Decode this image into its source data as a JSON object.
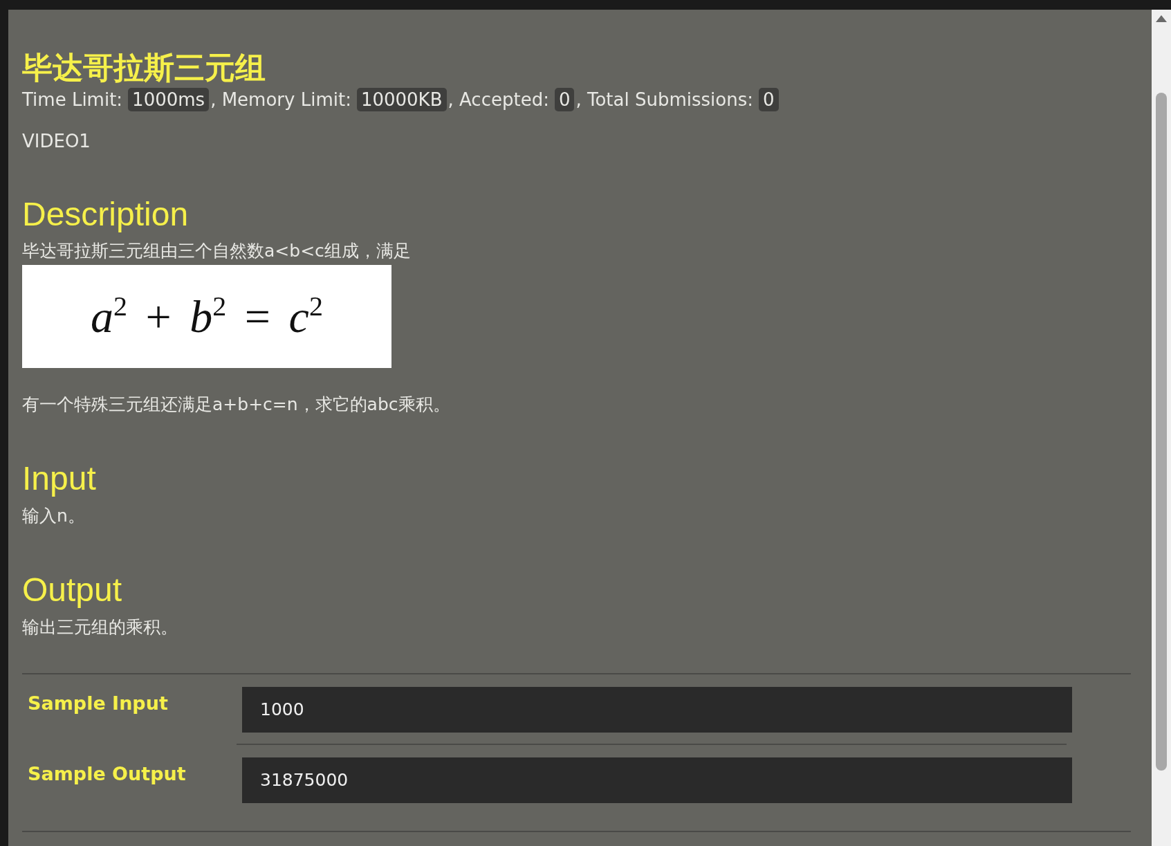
{
  "title": "毕达哥拉斯三元组",
  "limits": [
    {
      "label": "Time Limit:",
      "value": "1000ms"
    },
    {
      "label": ", Memory Limit:",
      "value": "10000KB"
    },
    {
      "label": ", Accepted:",
      "value": "0"
    },
    {
      "label": ", Total Submissions:",
      "value": "0"
    }
  ],
  "tag": "VIDEO1",
  "sections": [
    {
      "heading": "Description",
      "paragraphs": [
        {
          "kind": "text",
          "text": "毕达哥拉斯三元组由三个自然数a<b<c组成，满足"
        },
        {
          "kind": "formula",
          "text": "*a*$^{2}$ + *b*$^{2}$ = *c*$^{2}$"
        },
        {
          "kind": "text",
          "text": "有一个特殊三元组还满足a+b+c=n，求它的abc乘积。"
        }
      ]
    },
    {
      "heading": "Input",
      "paragraphs": [
        {
          "kind": "text",
          "text": "输入n。"
        }
      ]
    },
    {
      "heading": "Output",
      "paragraphs": [
        {
          "kind": "text",
          "text": "输出三元组的乘积。"
        }
      ]
    }
  ],
  "samples": [
    {
      "label": "Sample Input",
      "value": "1000"
    },
    {
      "label": "Sample Output",
      "value": "31875000"
    }
  ]
}
